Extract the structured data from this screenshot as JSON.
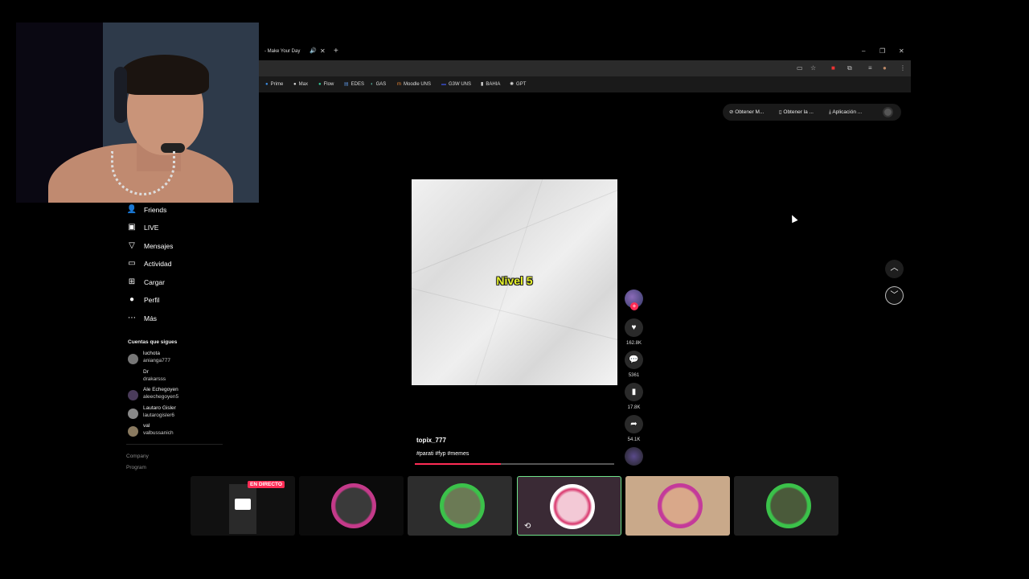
{
  "browser": {
    "tab_title": "- Make Your Day",
    "new_tab": "+",
    "bookmarks": [
      {
        "label": "Prime",
        "icon": "play-icon"
      },
      {
        "label": "Max",
        "icon": "max-icon"
      },
      {
        "label": "Flow",
        "icon": "flow-icon"
      },
      {
        "label": "EDES",
        "icon": "edes-icon"
      },
      {
        "label": "GAS",
        "icon": "gas-icon"
      },
      {
        "label": "Moodle UNS",
        "icon": "moodle-icon"
      },
      {
        "label": "G3W UNS",
        "icon": "g3w-icon"
      },
      {
        "label": "BAHIA",
        "icon": "bahia-icon"
      },
      {
        "label": "GPT",
        "icon": "gpt-icon"
      }
    ]
  },
  "sidebar": {
    "nav": [
      {
        "label": "Friends",
        "icon": "friends-icon"
      },
      {
        "label": "LIVE",
        "icon": "live-icon"
      },
      {
        "label": "Mensajes",
        "icon": "messages-icon"
      },
      {
        "label": "Actividad",
        "icon": "activity-icon"
      },
      {
        "label": "Cargar",
        "icon": "upload-icon"
      },
      {
        "label": "Perfil",
        "icon": "profile-icon"
      },
      {
        "label": "Más",
        "icon": "more-icon"
      }
    ],
    "following_title": "Cuentas que sigues",
    "following": [
      {
        "name": "luchota",
        "handle": "anianga777"
      },
      {
        "name": "Dr",
        "handle": "drakarsss"
      },
      {
        "name": "Ale Echegoyen",
        "handle": "aleechegoyen5"
      },
      {
        "name": "Lautaro Gisler",
        "handle": "lautarogisler6"
      },
      {
        "name": "val",
        "handle": "valbussanich"
      }
    ],
    "footer": [
      "Company",
      "Program"
    ]
  },
  "top_actions": {
    "pill1": "Obtener M...",
    "pill2": "Obtener la ...",
    "pill3": "Aplicación ..."
  },
  "video": {
    "overlay_text": "Nivel 5",
    "username": "topix_777",
    "hashtags": "#parati #fyp #memes",
    "progress": 0.43
  },
  "actions": {
    "likes": "162.8K",
    "comments": "5361",
    "saves": "17.8K",
    "shares": "54.1K"
  },
  "live": {
    "badge": "EN DIRECTO"
  },
  "colors": {
    "accent": "#fe2c55",
    "video_text": "#e8f52a",
    "background": "#000000"
  }
}
